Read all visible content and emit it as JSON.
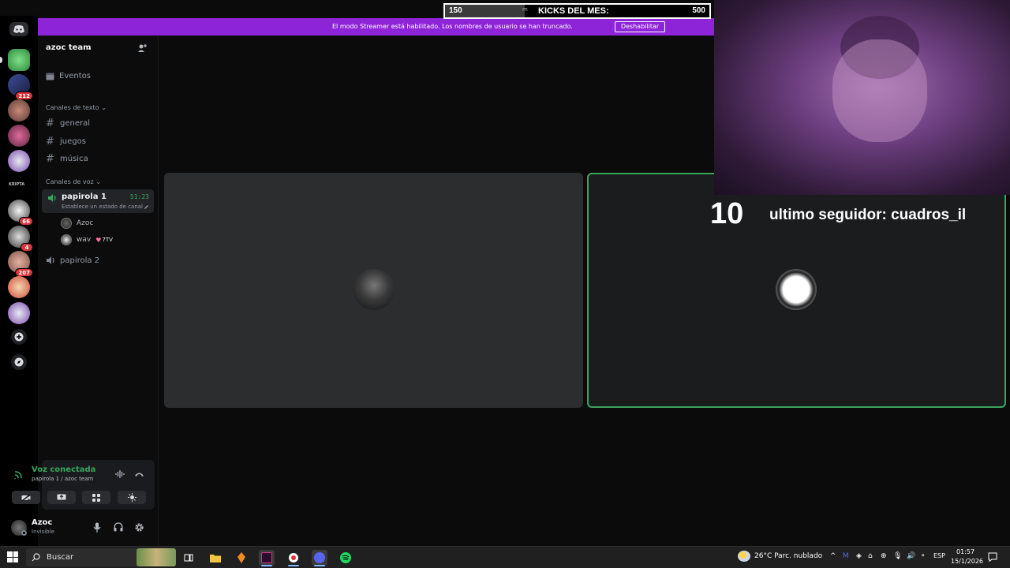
{
  "kicks_goal": {
    "start": "150",
    "title": "KICKS DEL MES:",
    "goal": "500",
    "m_mark": "m",
    "progress_fraction": 0.3
  },
  "banner": {
    "text": "El modo Streamer está habilitado. Los nombres de usuario se han truncado.",
    "button": "Deshabilitar"
  },
  "rail": {
    "badges": [
      "212",
      "66",
      "4",
      "207"
    ],
    "server_label": "KRIPTA"
  },
  "sidebar": {
    "server_name": "azoc team",
    "events_label": "Eventos",
    "text_category": "Canales de texto",
    "text_channels": [
      "general",
      "juegos",
      "música"
    ],
    "voice_category": "Canales de voz",
    "voice_channels": [
      {
        "name": "papirola 1",
        "time": "51:23",
        "status": "Establece un estado de canal",
        "users": [
          "Azoc",
          "wav"
        ],
        "user_tag": "7TV"
      },
      {
        "name": "papirola 2"
      }
    ]
  },
  "voice_panel": {
    "status": "Voz conectada",
    "location": "papirola 1 / azoc team"
  },
  "user": {
    "name": "Azoc",
    "status": "Invisible"
  },
  "overlay": {
    "follower_count": "10",
    "follower_text": "ultimo seguidor: cuadros_il"
  },
  "taskbar": {
    "search": "Buscar",
    "weather": "26°C  Parc. nublado",
    "lang": "ESP",
    "time": "01:57",
    "date": "15/1/2026"
  },
  "colors": {
    "streamer_purple": "#8e24d8",
    "voice_green": "#3ba55d",
    "badge_red": "#da373c"
  }
}
